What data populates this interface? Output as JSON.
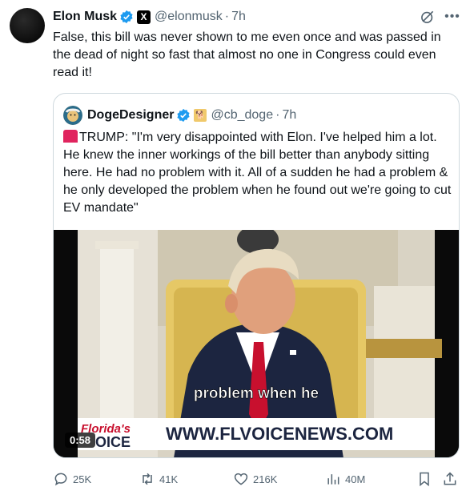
{
  "tweet": {
    "author_name": "Elon Musk",
    "handle": "@elonmusk",
    "separator": "·",
    "time": "7h",
    "affiliation_badge": "X",
    "text": "False, this bill was never shown to me even once and was passed in the dead of night so fast that almost no one in Congress could even read it!"
  },
  "quote": {
    "author_name": "DogeDesigner",
    "handle": "@cb_doge",
    "separator": "·",
    "time": "7h",
    "text": "TRUMP: \"I'm very disappointed with Elon. I've helped him a lot. He knew the inner workings of the bill better than anybody sitting here. He had no problem with it. All of a sudden he had a problem & he only developed the problem when he found out we're going to cut EV mandate\"",
    "video": {
      "caption": "problem when he",
      "logo_top": "Florida's",
      "logo_bottom": "OICE",
      "banner": "WWW.FLVOICENEWS.COM",
      "duration": "0:58"
    }
  },
  "actions": {
    "replies": "25K",
    "reposts": "41K",
    "likes": "216K",
    "views": "40M"
  },
  "colors": {
    "verified_blue": "#1d9bf0",
    "secondary_text": "#536471",
    "tie_red": "#c8102e",
    "suit_navy": "#1c2540"
  },
  "icons": [
    "verified-badge-icon",
    "grok-icon",
    "more-icon",
    "reply-icon",
    "repost-icon",
    "like-icon",
    "views-icon",
    "bookmark-icon",
    "share-icon",
    "siren-icon"
  ]
}
